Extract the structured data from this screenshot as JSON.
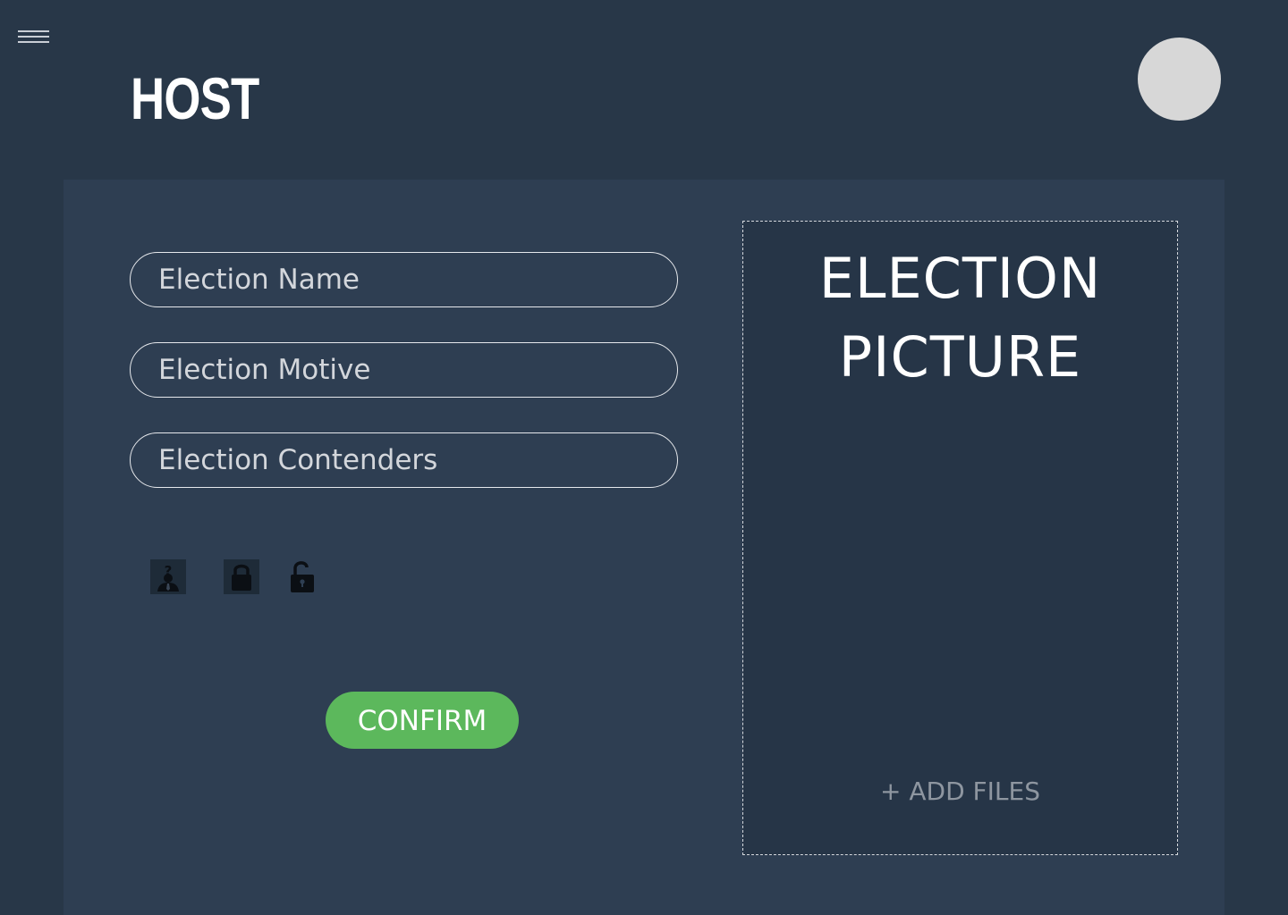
{
  "header": {
    "title": "HOST",
    "menu_icon": "hamburger-menu-icon",
    "avatar_icon": "user-avatar"
  },
  "form": {
    "election_name_placeholder": "Election Name",
    "election_motive_placeholder": "Election Motive",
    "election_contenders_placeholder": "Election Contenders",
    "options": [
      {
        "icon": "anonymous-person-icon"
      },
      {
        "icon": "lock-icon"
      },
      {
        "icon": "unlock-icon"
      }
    ],
    "confirm_label": "CONFIRM"
  },
  "picture": {
    "title_line1": "ELECTION",
    "title_line2": "PICTURE",
    "add_files_label": "+ ADD FILES"
  },
  "colors": {
    "background": "#283748",
    "panel": "#2e3e52",
    "dropzone": "#263547",
    "accent_green": "#5cb85c",
    "avatar": "#d7d7d7"
  }
}
